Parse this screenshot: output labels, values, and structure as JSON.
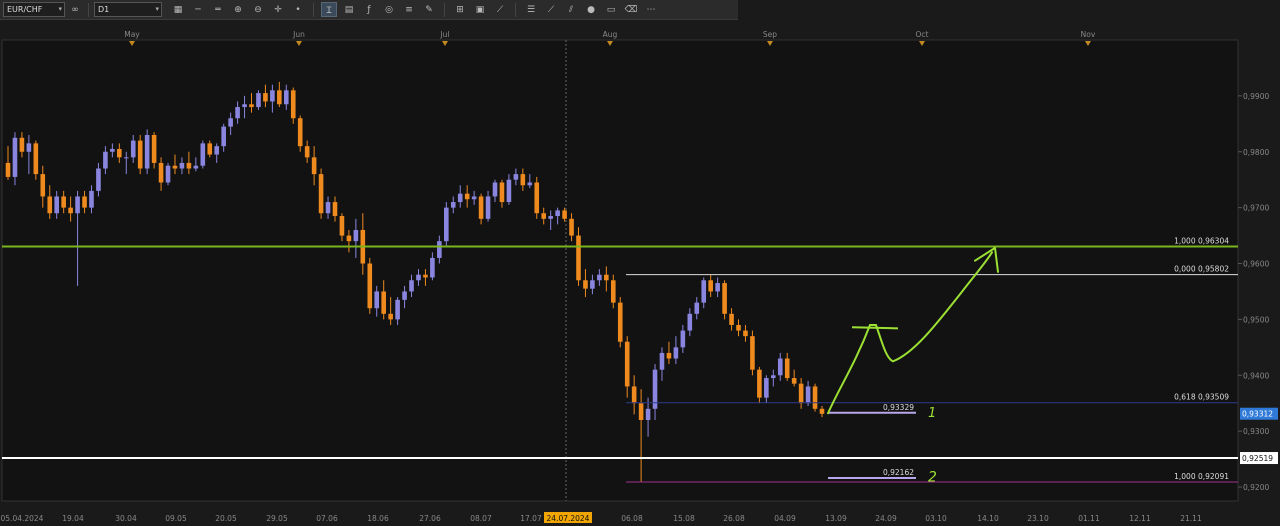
{
  "toolbar": {
    "symbol": "EUR/CHF",
    "timeframe": "D1",
    "buttons": [
      {
        "name": "chart-type-icon",
        "glyph": "▦"
      },
      {
        "name": "line-tool-icon",
        "glyph": "─"
      },
      {
        "name": "hline-tool-icon",
        "glyph": "═"
      },
      {
        "name": "zoom-in-icon",
        "glyph": "⊕"
      },
      {
        "name": "zoom-out-icon",
        "glyph": "⊖"
      },
      {
        "name": "crosshair-icon",
        "glyph": "✛"
      },
      {
        "name": "dot-icon",
        "glyph": "•"
      },
      {
        "name": "cursor-text-icon",
        "glyph": "Ɪ"
      },
      {
        "name": "template-icon",
        "glyph": "▤"
      },
      {
        "name": "indicator-icon",
        "glyph": "ƒ"
      },
      {
        "name": "globe-icon",
        "glyph": "◎"
      },
      {
        "name": "fib-icon",
        "glyph": "≡"
      },
      {
        "name": "pencil-icon",
        "glyph": "✎"
      },
      {
        "name": "grid-icon",
        "glyph": "⊞"
      },
      {
        "name": "calendar-icon",
        "glyph": "▣"
      },
      {
        "name": "draw-tool-icon",
        "glyph": "⟋"
      },
      {
        "name": "layers-icon",
        "glyph": "☰"
      },
      {
        "name": "trend-tool-icon",
        "glyph": "⟋"
      },
      {
        "name": "channel-tool-icon",
        "glyph": "⫽"
      },
      {
        "name": "circle-icon",
        "glyph": "●"
      },
      {
        "name": "window-icon",
        "glyph": "▭"
      },
      {
        "name": "eraser-icon",
        "glyph": "⌫"
      },
      {
        "name": "more-icon",
        "glyph": "⋯"
      }
    ]
  },
  "colors": {
    "bg": "#1a1a1a",
    "plot_bg": "#121212",
    "bull": "#8a86e0",
    "bear": "#ee8a1e",
    "green_line": "#7ab51d",
    "white_line": "#ffffff",
    "blue_line": "#2c3a8a",
    "magenta_line": "#a0308a",
    "lavender": "#b8a6ea",
    "annot": "#9be033",
    "label_blue": "#2f7ad8",
    "date_highlight": "#f0a500"
  },
  "chart_data": {
    "type": "candlestick",
    "symbol": "EUR/CHF",
    "timeframe": "D1",
    "ylim": [
      0.9175,
      1.0
    ],
    "y_ticks": [
      "0,9900",
      "0,9800",
      "0,9700",
      "0,9600",
      "0,9500",
      "0,9400",
      "0,9300",
      "0,9200"
    ],
    "y_tick_values": [
      0.99,
      0.98,
      0.97,
      0.96,
      0.95,
      0.94,
      0.93,
      0.92
    ],
    "x_dates": [
      "05.04.2024",
      "19.04",
      "30.04",
      "09.05",
      "20.05",
      "29.05",
      "07.06",
      "18.06",
      "27.06",
      "08.07",
      "17.07",
      "24.07.2024",
      "06.08",
      "15.08",
      "26.08",
      "04.09",
      "13.09",
      "24.09",
      "03.10",
      "14.10",
      "23.10",
      "01.11",
      "12.11",
      "21.11"
    ],
    "highlighted_date": "24.07.2024",
    "month_labels": [
      "May",
      "Jun",
      "Jul",
      "Aug",
      "Sep",
      "Oct",
      "Nov"
    ],
    "levels": [
      {
        "label": "1,000 0,96304",
        "value": 0.96304,
        "kind": "fib"
      },
      {
        "label": "0,000 0,95802",
        "value": 0.95802,
        "kind": "fib"
      },
      {
        "label": "0,618 0,93509",
        "value": 0.93509,
        "kind": "fib"
      },
      {
        "label": "1,000 0,92091",
        "value": 0.92091,
        "kind": "fib"
      },
      {
        "label": "0,93329",
        "value": 0.93329,
        "kind": "target"
      },
      {
        "label": "0,92162",
        "value": 0.92162,
        "kind": "target"
      },
      {
        "label": "0,92519",
        "value": 0.92519,
        "kind": "support"
      }
    ],
    "current_price": "0,93312",
    "annotations": [
      "1",
      "2"
    ],
    "candles": [
      {
        "o": 0.978,
        "h": 0.981,
        "l": 0.975,
        "c": 0.9755
      },
      {
        "o": 0.9755,
        "h": 0.9835,
        "l": 0.974,
        "c": 0.9825
      },
      {
        "o": 0.9825,
        "h": 0.9835,
        "l": 0.979,
        "c": 0.98
      },
      {
        "o": 0.98,
        "h": 0.983,
        "l": 0.976,
        "c": 0.9815
      },
      {
        "o": 0.9815,
        "h": 0.982,
        "l": 0.975,
        "c": 0.976
      },
      {
        "o": 0.976,
        "h": 0.9775,
        "l": 0.97,
        "c": 0.972
      },
      {
        "o": 0.972,
        "h": 0.974,
        "l": 0.968,
        "c": 0.969
      },
      {
        "o": 0.969,
        "h": 0.973,
        "l": 0.968,
        "c": 0.972
      },
      {
        "o": 0.972,
        "h": 0.973,
        "l": 0.969,
        "c": 0.97
      },
      {
        "o": 0.97,
        "h": 0.972,
        "l": 0.9675,
        "c": 0.969
      },
      {
        "o": 0.969,
        "h": 0.973,
        "l": 0.956,
        "c": 0.972
      },
      {
        "o": 0.972,
        "h": 0.973,
        "l": 0.969,
        "c": 0.97
      },
      {
        "o": 0.97,
        "h": 0.974,
        "l": 0.969,
        "c": 0.973
      },
      {
        "o": 0.973,
        "h": 0.978,
        "l": 0.972,
        "c": 0.977
      },
      {
        "o": 0.977,
        "h": 0.981,
        "l": 0.976,
        "c": 0.98
      },
      {
        "o": 0.98,
        "h": 0.9815,
        "l": 0.979,
        "c": 0.9805
      },
      {
        "o": 0.9805,
        "h": 0.9815,
        "l": 0.978,
        "c": 0.979
      },
      {
        "o": 0.979,
        "h": 0.98,
        "l": 0.976,
        "c": 0.979
      },
      {
        "o": 0.979,
        "h": 0.983,
        "l": 0.978,
        "c": 0.982
      },
      {
        "o": 0.982,
        "h": 0.983,
        "l": 0.976,
        "c": 0.977
      },
      {
        "o": 0.977,
        "h": 0.984,
        "l": 0.976,
        "c": 0.983
      },
      {
        "o": 0.983,
        "h": 0.9835,
        "l": 0.977,
        "c": 0.978
      },
      {
        "o": 0.978,
        "h": 0.979,
        "l": 0.973,
        "c": 0.9745
      },
      {
        "o": 0.9745,
        "h": 0.978,
        "l": 0.974,
        "c": 0.9775
      },
      {
        "o": 0.9775,
        "h": 0.9795,
        "l": 0.976,
        "c": 0.977
      },
      {
        "o": 0.977,
        "h": 0.979,
        "l": 0.976,
        "c": 0.978
      },
      {
        "o": 0.978,
        "h": 0.98,
        "l": 0.976,
        "c": 0.977
      },
      {
        "o": 0.977,
        "h": 0.979,
        "l": 0.9765,
        "c": 0.9775
      },
      {
        "o": 0.9775,
        "h": 0.982,
        "l": 0.977,
        "c": 0.9815
      },
      {
        "o": 0.9815,
        "h": 0.982,
        "l": 0.979,
        "c": 0.9795
      },
      {
        "o": 0.9795,
        "h": 0.9815,
        "l": 0.978,
        "c": 0.981
      },
      {
        "o": 0.981,
        "h": 0.985,
        "l": 0.98,
        "c": 0.9845
      },
      {
        "o": 0.9845,
        "h": 0.987,
        "l": 0.983,
        "c": 0.986
      },
      {
        "o": 0.986,
        "h": 0.989,
        "l": 0.985,
        "c": 0.988
      },
      {
        "o": 0.988,
        "h": 0.99,
        "l": 0.986,
        "c": 0.9885
      },
      {
        "o": 0.9885,
        "h": 0.9905,
        "l": 0.987,
        "c": 0.988
      },
      {
        "o": 0.988,
        "h": 0.991,
        "l": 0.9875,
        "c": 0.9905
      },
      {
        "o": 0.9905,
        "h": 0.992,
        "l": 0.988,
        "c": 0.989
      },
      {
        "o": 0.989,
        "h": 0.992,
        "l": 0.987,
        "c": 0.991
      },
      {
        "o": 0.991,
        "h": 0.9925,
        "l": 0.988,
        "c": 0.9885
      },
      {
        "o": 0.9885,
        "h": 0.992,
        "l": 0.9875,
        "c": 0.991
      },
      {
        "o": 0.991,
        "h": 0.9915,
        "l": 0.985,
        "c": 0.986
      },
      {
        "o": 0.986,
        "h": 0.9865,
        "l": 0.98,
        "c": 0.981
      },
      {
        "o": 0.981,
        "h": 0.982,
        "l": 0.978,
        "c": 0.979
      },
      {
        "o": 0.979,
        "h": 0.981,
        "l": 0.974,
        "c": 0.976
      },
      {
        "o": 0.976,
        "h": 0.977,
        "l": 0.968,
        "c": 0.969
      },
      {
        "o": 0.969,
        "h": 0.972,
        "l": 0.968,
        "c": 0.971
      },
      {
        "o": 0.971,
        "h": 0.972,
        "l": 0.9675,
        "c": 0.9685
      },
      {
        "o": 0.9685,
        "h": 0.969,
        "l": 0.964,
        "c": 0.965
      },
      {
        "o": 0.965,
        "h": 0.966,
        "l": 0.962,
        "c": 0.964
      },
      {
        "o": 0.964,
        "h": 0.968,
        "l": 0.961,
        "c": 0.966
      },
      {
        "o": 0.966,
        "h": 0.969,
        "l": 0.958,
        "c": 0.96
      },
      {
        "o": 0.96,
        "h": 0.961,
        "l": 0.951,
        "c": 0.952
      },
      {
        "o": 0.952,
        "h": 0.956,
        "l": 0.9505,
        "c": 0.955
      },
      {
        "o": 0.955,
        "h": 0.957,
        "l": 0.95,
        "c": 0.951
      },
      {
        "o": 0.951,
        "h": 0.954,
        "l": 0.949,
        "c": 0.95
      },
      {
        "o": 0.95,
        "h": 0.954,
        "l": 0.949,
        "c": 0.9535
      },
      {
        "o": 0.9535,
        "h": 0.956,
        "l": 0.952,
        "c": 0.955
      },
      {
        "o": 0.955,
        "h": 0.958,
        "l": 0.954,
        "c": 0.957
      },
      {
        "o": 0.957,
        "h": 0.959,
        "l": 0.956,
        "c": 0.958
      },
      {
        "o": 0.958,
        "h": 0.959,
        "l": 0.956,
        "c": 0.9575
      },
      {
        "o": 0.9575,
        "h": 0.962,
        "l": 0.957,
        "c": 0.961
      },
      {
        "o": 0.961,
        "h": 0.965,
        "l": 0.96,
        "c": 0.964
      },
      {
        "o": 0.964,
        "h": 0.971,
        "l": 0.963,
        "c": 0.97
      },
      {
        "o": 0.97,
        "h": 0.972,
        "l": 0.969,
        "c": 0.971
      },
      {
        "o": 0.971,
        "h": 0.974,
        "l": 0.97,
        "c": 0.9725
      },
      {
        "o": 0.9725,
        "h": 0.974,
        "l": 0.97,
        "c": 0.9715
      },
      {
        "o": 0.9715,
        "h": 0.973,
        "l": 0.9705,
        "c": 0.972
      },
      {
        "o": 0.972,
        "h": 0.9725,
        "l": 0.967,
        "c": 0.968
      },
      {
        "o": 0.968,
        "h": 0.973,
        "l": 0.9675,
        "c": 0.972
      },
      {
        "o": 0.972,
        "h": 0.975,
        "l": 0.971,
        "c": 0.9745
      },
      {
        "o": 0.9745,
        "h": 0.975,
        "l": 0.97,
        "c": 0.971
      },
      {
        "o": 0.971,
        "h": 0.976,
        "l": 0.9705,
        "c": 0.975
      },
      {
        "o": 0.975,
        "h": 0.977,
        "l": 0.974,
        "c": 0.976
      },
      {
        "o": 0.976,
        "h": 0.977,
        "l": 0.973,
        "c": 0.974
      },
      {
        "o": 0.974,
        "h": 0.976,
        "l": 0.9735,
        "c": 0.9745
      },
      {
        "o": 0.9745,
        "h": 0.9755,
        "l": 0.968,
        "c": 0.969
      },
      {
        "o": 0.969,
        "h": 0.97,
        "l": 0.967,
        "c": 0.968
      },
      {
        "o": 0.968,
        "h": 0.9695,
        "l": 0.966,
        "c": 0.9685
      },
      {
        "o": 0.9685,
        "h": 0.97,
        "l": 0.967,
        "c": 0.9695
      },
      {
        "o": 0.9695,
        "h": 0.97,
        "l": 0.9675,
        "c": 0.968
      },
      {
        "o": 0.968,
        "h": 0.969,
        "l": 0.964,
        "c": 0.965
      },
      {
        "o": 0.965,
        "h": 0.9665,
        "l": 0.956,
        "c": 0.957
      },
      {
        "o": 0.957,
        "h": 0.959,
        "l": 0.954,
        "c": 0.9555
      },
      {
        "o": 0.9555,
        "h": 0.958,
        "l": 0.9545,
        "c": 0.957
      },
      {
        "o": 0.957,
        "h": 0.959,
        "l": 0.956,
        "c": 0.958
      },
      {
        "o": 0.958,
        "h": 0.9595,
        "l": 0.955,
        "c": 0.957
      },
      {
        "o": 0.957,
        "h": 0.958,
        "l": 0.952,
        "c": 0.953
      },
      {
        "o": 0.953,
        "h": 0.954,
        "l": 0.945,
        "c": 0.946
      },
      {
        "o": 0.946,
        "h": 0.947,
        "l": 0.936,
        "c": 0.938
      },
      {
        "o": 0.938,
        "h": 0.94,
        "l": 0.933,
        "c": 0.935
      },
      {
        "o": 0.935,
        "h": 0.9375,
        "l": 0.9209,
        "c": 0.932
      },
      {
        "o": 0.932,
        "h": 0.936,
        "l": 0.929,
        "c": 0.934
      },
      {
        "o": 0.934,
        "h": 0.942,
        "l": 0.932,
        "c": 0.941
      },
      {
        "o": 0.941,
        "h": 0.945,
        "l": 0.939,
        "c": 0.944
      },
      {
        "o": 0.944,
        "h": 0.946,
        "l": 0.942,
        "c": 0.943
      },
      {
        "o": 0.943,
        "h": 0.947,
        "l": 0.942,
        "c": 0.945
      },
      {
        "o": 0.945,
        "h": 0.949,
        "l": 0.944,
        "c": 0.948
      },
      {
        "o": 0.948,
        "h": 0.952,
        "l": 0.947,
        "c": 0.951
      },
      {
        "o": 0.951,
        "h": 0.954,
        "l": 0.95,
        "c": 0.953
      },
      {
        "o": 0.953,
        "h": 0.9575,
        "l": 0.952,
        "c": 0.957
      },
      {
        "o": 0.957,
        "h": 0.958,
        "l": 0.954,
        "c": 0.955
      },
      {
        "o": 0.955,
        "h": 0.9575,
        "l": 0.954,
        "c": 0.9565
      },
      {
        "o": 0.9565,
        "h": 0.957,
        "l": 0.95,
        "c": 0.951
      },
      {
        "o": 0.951,
        "h": 0.952,
        "l": 0.948,
        "c": 0.949
      },
      {
        "o": 0.949,
        "h": 0.95,
        "l": 0.947,
        "c": 0.948
      },
      {
        "o": 0.948,
        "h": 0.949,
        "l": 0.946,
        "c": 0.947
      },
      {
        "o": 0.947,
        "h": 0.948,
        "l": 0.94,
        "c": 0.941
      },
      {
        "o": 0.941,
        "h": 0.9415,
        "l": 0.935,
        "c": 0.936
      },
      {
        "o": 0.936,
        "h": 0.94,
        "l": 0.935,
        "c": 0.9395
      },
      {
        "o": 0.9395,
        "h": 0.941,
        "l": 0.938,
        "c": 0.94
      },
      {
        "o": 0.94,
        "h": 0.944,
        "l": 0.939,
        "c": 0.943
      },
      {
        "o": 0.943,
        "h": 0.944,
        "l": 0.939,
        "c": 0.9395
      },
      {
        "o": 0.9395,
        "h": 0.941,
        "l": 0.938,
        "c": 0.9385
      },
      {
        "o": 0.9385,
        "h": 0.9395,
        "l": 0.934,
        "c": 0.935
      },
      {
        "o": 0.935,
        "h": 0.939,
        "l": 0.9345,
        "c": 0.938
      },
      {
        "o": 0.938,
        "h": 0.9385,
        "l": 0.9335,
        "c": 0.934
      },
      {
        "o": 0.934,
        "h": 0.9345,
        "l": 0.9325,
        "c": 0.9331
      }
    ]
  }
}
